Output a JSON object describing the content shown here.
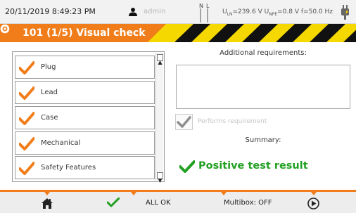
{
  "status": {
    "datetime": "20/11/2019 8:49:23 PM",
    "user": "admin",
    "n_label": "N",
    "l_label": "L",
    "readings": {
      "uln_prefix": "U",
      "uln_sub": "LN",
      "uln_value": "=239.6 V",
      "upe_prefix": "U",
      "upe_sub": "NPE",
      "upe_value": "=0.8 V",
      "freq": "f=50.0 Hz"
    }
  },
  "title": {
    "text": "101 (1/5) Visual check",
    "icon": "eye-icon"
  },
  "checklist": {
    "items": [
      {
        "label": "Plug",
        "checked": true
      },
      {
        "label": "Lead",
        "checked": true
      },
      {
        "label": "Case",
        "checked": true
      },
      {
        "label": "Mechanical",
        "checked": true
      },
      {
        "label": "Safety Features",
        "checked": true
      }
    ]
  },
  "right_panel": {
    "additional_requirements_label": "Additional requirements:",
    "additional_requirements_value": "",
    "performs_requirement_label": "Performs requirement",
    "summary_label": "Summary:",
    "result_text": "Positive test result"
  },
  "bottom_bar": {
    "home_icon": "home-icon",
    "all_ok_icon": "checkmark-icon",
    "all_ok_label": "ALL OK",
    "multibox_label": "Multibox: OFF",
    "next_icon": "next-arrow-icon"
  },
  "colors": {
    "accent_orange": "#f07d1a",
    "hazard_black": "#111111",
    "hazard_yellow": "#f5d800",
    "check_orange": "#f07d1a",
    "result_green": "#22a022"
  }
}
